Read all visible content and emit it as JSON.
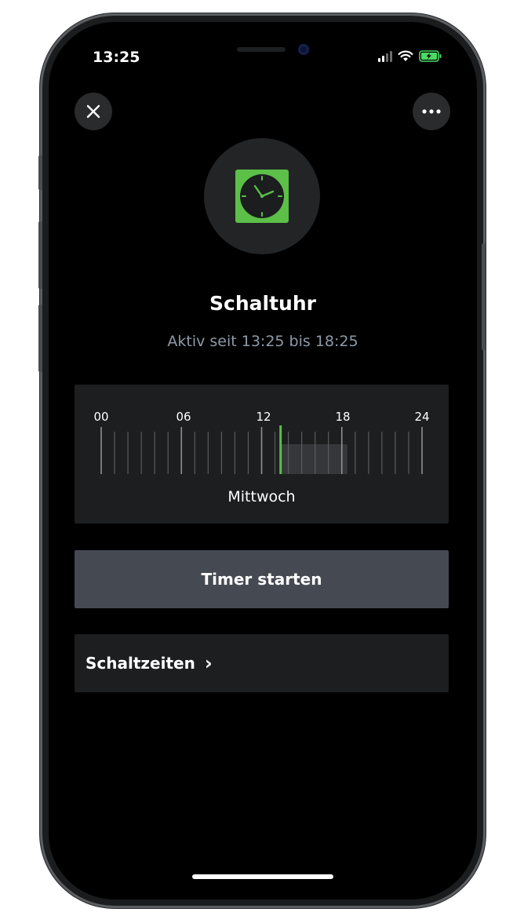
{
  "status_bar": {
    "time": "13:25",
    "battery_color": "#4cd964"
  },
  "header": {
    "close_icon": "close-icon",
    "more_icon": "more-horizontal-icon"
  },
  "device": {
    "icon": "clock-icon",
    "icon_color": "#5bbf48",
    "title": "Schaltuhr",
    "subtitle": "Aktiv seit 13:25 bis 18:25"
  },
  "timeline": {
    "hour_labels": [
      "00",
      "06",
      "12",
      "18",
      "24"
    ],
    "day": "Mittwoch",
    "current_hour": 13.42,
    "active_from_hour": 13.42,
    "active_to_hour": 18.42,
    "accent_color": "#5bbf48"
  },
  "actions": {
    "start_timer_label": "Timer starten",
    "schedules_label": "Schaltzeiten",
    "schedules_chevron": "›"
  }
}
